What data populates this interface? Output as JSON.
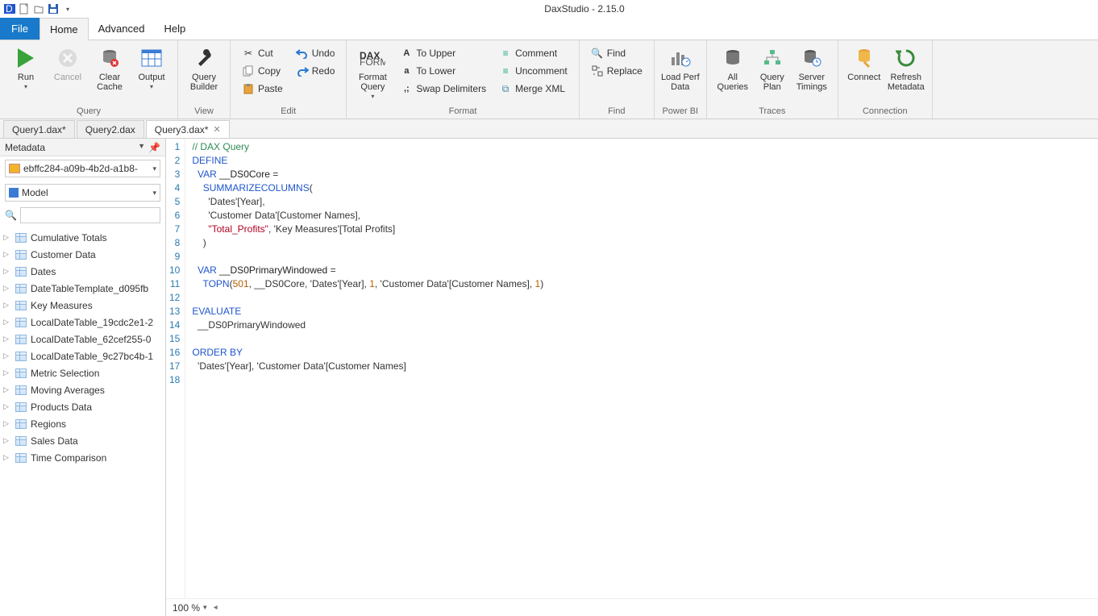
{
  "app": {
    "title": "DaxStudio - 2.15.0"
  },
  "qat": {},
  "menu": {
    "file": "File",
    "home": "Home",
    "advanced": "Advanced",
    "help": "Help"
  },
  "ribbon": {
    "query": {
      "label": "Query",
      "run": "Run",
      "cancel": "Cancel",
      "clear_cache": "Clear\nCache",
      "output": "Output"
    },
    "view": {
      "label": "View",
      "query_builder": "Query\nBuilder"
    },
    "edit": {
      "label": "Edit",
      "cut": "Cut",
      "copy": "Copy",
      "paste": "Paste",
      "undo": "Undo",
      "redo": "Redo"
    },
    "formatgrp": {
      "label": "Format",
      "format_query": "Format\nQuery",
      "to_upper": "To Upper",
      "to_lower": "To Lower",
      "swap": "Swap Delimiters",
      "comment": "Comment",
      "uncomment": "Uncomment",
      "merge_xml": "Merge XML"
    },
    "find": {
      "label": "Find",
      "find": "Find",
      "replace": "Replace"
    },
    "powerbi": {
      "label": "Power BI",
      "load_perf": "Load Perf\nData"
    },
    "traces": {
      "label": "Traces",
      "all_queries": "All\nQueries",
      "query_plan": "Query\nPlan",
      "server_timings": "Server\nTimings"
    },
    "connection": {
      "label": "Connection",
      "connect": "Connect",
      "refresh": "Refresh\nMetadata"
    }
  },
  "doctabs": [
    {
      "label": "Query1.dax*",
      "active": false,
      "closable": false
    },
    {
      "label": "Query2.dax",
      "active": false,
      "closable": false
    },
    {
      "label": "Query3.dax*",
      "active": true,
      "closable": true
    }
  ],
  "sidebar": {
    "title": "Metadata",
    "db": "ebffc284-a09b-4b2d-a1b8-",
    "model": "Model",
    "tables": [
      "Cumulative Totals",
      "Customer Data",
      "Dates",
      "DateTableTemplate_d095fb",
      "Key Measures",
      "LocalDateTable_19cdc2e1-2",
      "LocalDateTable_62cef255-0",
      "LocalDateTable_9c27bc4b-1",
      "Metric Selection",
      "Moving Averages",
      "Products Data",
      "Regions",
      "Sales Data",
      "Time Comparison"
    ]
  },
  "editor": {
    "lines": [
      {
        "n": 1,
        "html": "<span class='c-comment'>// DAX Query</span>"
      },
      {
        "n": 2,
        "html": "<span class='c-kw'>DEFINE</span>"
      },
      {
        "n": 3,
        "html": "  <span class='c-kw'>VAR</span> <span class='c-id'>__DS0Core</span> ="
      },
      {
        "n": 4,
        "html": "    <span class='c-fn'>SUMMARIZECOLUMNS</span>("
      },
      {
        "n": 5,
        "html": "      'Dates'[Year],"
      },
      {
        "n": 6,
        "html": "      'Customer Data'[Customer Names],"
      },
      {
        "n": 7,
        "html": "      <span class='c-str'>\"Total_Profits\"</span>, 'Key Measures'[Total Profits]"
      },
      {
        "n": 8,
        "html": "    )"
      },
      {
        "n": 9,
        "html": " "
      },
      {
        "n": 10,
        "html": "  <span class='c-kw'>VAR</span> <span class='c-id'>__DS0PrimaryWindowed</span> ="
      },
      {
        "n": 11,
        "html": "    <span class='c-fn'>TOPN</span>(<span class='c-num'>501</span>, __DS0Core, 'Dates'[Year], <span class='c-num'>1</span>, 'Customer Data'[Customer Names], <span class='c-num'>1</span>)"
      },
      {
        "n": 12,
        "html": " "
      },
      {
        "n": 13,
        "html": "<span class='c-kw'>EVALUATE</span>"
      },
      {
        "n": 14,
        "html": "  __DS0PrimaryWindowed"
      },
      {
        "n": 15,
        "html": " "
      },
      {
        "n": 16,
        "html": "<span class='c-kw'>ORDER BY</span>"
      },
      {
        "n": 17,
        "html": "  'Dates'[Year], 'Customer Data'[Customer Names]"
      },
      {
        "n": 18,
        "html": " "
      }
    ],
    "zoom": "100 %"
  }
}
